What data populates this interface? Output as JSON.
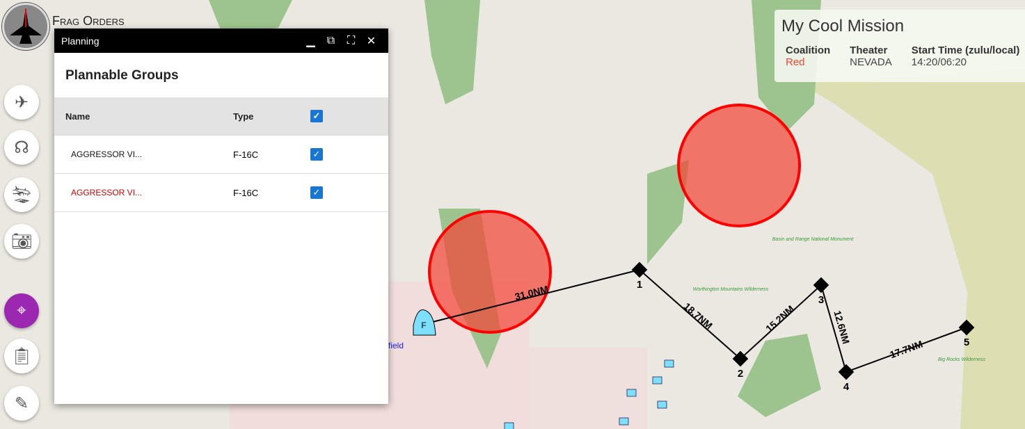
{
  "app": {
    "brand": "Frag Orders"
  },
  "sidebar": {
    "items": [
      {
        "name": "aircraft",
        "icon": "airplane-icon"
      },
      {
        "name": "support",
        "icon": "headset-icon"
      },
      {
        "name": "landing",
        "icon": "plane-landing-icon"
      },
      {
        "name": "camera",
        "icon": "camera-icon"
      },
      {
        "name": "target",
        "icon": "crosshair-icon",
        "active": true
      },
      {
        "name": "clipboard",
        "icon": "clipboard-icon"
      },
      {
        "name": "edit",
        "icon": "clipboard-edit-icon"
      }
    ]
  },
  "window": {
    "title": "Planning",
    "heading": "Plannable Groups",
    "columns": [
      "Name",
      "Type"
    ],
    "rows": [
      {
        "name": "AGGRESSOR VI...",
        "type": "F-16C",
        "checked": true,
        "color": "#111111"
      },
      {
        "name": "AGGRESSOR VI...",
        "type": "F-16C",
        "checked": true,
        "color": "#d50000"
      }
    ]
  },
  "mission": {
    "title": "My Cool Mission",
    "coalition_label": "Coalition",
    "coalition": "Red",
    "theater_label": "Theater",
    "theater": "NEVADA",
    "start_label": "Start Time (zulu/local)",
    "start": "14:20/06:20",
    "coalition_color": "#f44336"
  },
  "map": {
    "start_marker": "F",
    "waypoints": [
      "1",
      "2",
      "3",
      "4",
      "5"
    ],
    "legs": [
      "31.0NM",
      "18.7NM",
      "15.2NM",
      "12.6NM",
      "17.7NM"
    ],
    "labels": [
      "Basin and Range National Monument",
      "Worthington Mountains Wilderness",
      "Big Rocks Wilderness",
      "field"
    ]
  }
}
